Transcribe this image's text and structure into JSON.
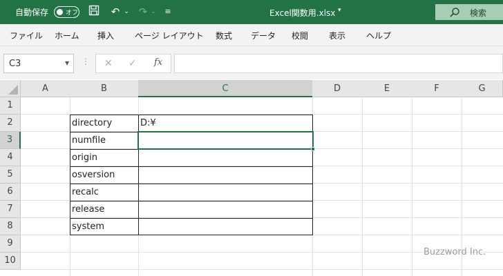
{
  "titlebar": {
    "autosave_label": "自動保存",
    "autosave_state": "オフ",
    "document_title": "Excel関数用.xlsx",
    "search_label": "検索"
  },
  "ribbon": {
    "tabs": [
      "ファイル",
      "ホーム",
      "挿入",
      "ページ レイアウト",
      "数式",
      "データ",
      "校閲",
      "表示",
      "ヘルプ"
    ]
  },
  "formula_bar": {
    "name_box": "C3",
    "cancel_icon": "✕",
    "enter_icon": "✓",
    "fx_label": "fx",
    "formula": ""
  },
  "sheet": {
    "columns": [
      "A",
      "B",
      "C",
      "D",
      "E",
      "F",
      "G"
    ],
    "rows": [
      "1",
      "2",
      "3",
      "4",
      "5",
      "6",
      "7",
      "8",
      "9",
      "10"
    ],
    "active_cell": "C3",
    "cells": {
      "B2": "directory",
      "C2": "D:¥",
      "B3": "numfile",
      "B4": "origin",
      "B5": "osversion",
      "B6": "recalc",
      "B7": "release",
      "B8": "system"
    }
  },
  "watermark": "Buzzword Inc.",
  "colors": {
    "accent": "#217346"
  }
}
